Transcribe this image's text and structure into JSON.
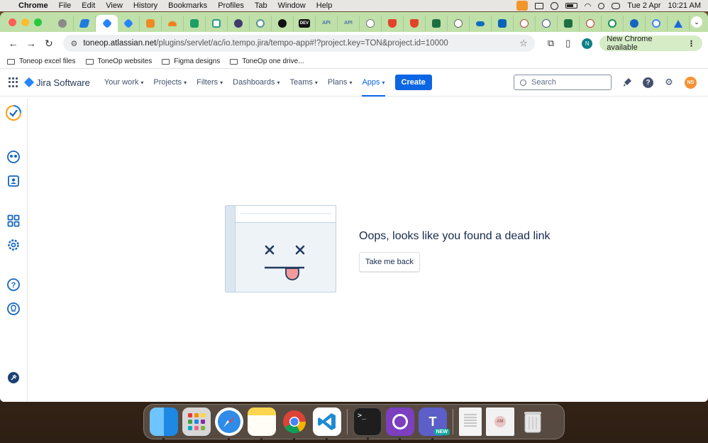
{
  "menubar": {
    "app": "Chrome",
    "items": [
      "File",
      "Edit",
      "View",
      "History",
      "Bookmarks",
      "Profiles",
      "Tab",
      "Window",
      "Help"
    ],
    "date": "Tue 2 Apr",
    "time": "10:21 AM"
  },
  "tabs": {
    "favicons": [
      "apple",
      "tempo",
      "jira",
      "orange-cube",
      "cloudflare",
      "green-doc",
      "teal-square",
      "shield",
      "compass",
      "circle-dark",
      "dev",
      "api-1",
      "api-2",
      "openai",
      "gitlab-1",
      "gitlab-2",
      "excel",
      "chatgpt",
      "onedrive",
      "outlook",
      "grammar",
      "github-desktop",
      "excel-2",
      "grammarly",
      "teal-circle",
      "accessibility",
      "google",
      "atlassian"
    ],
    "dev_label": "DEV",
    "api_label": "API",
    "new_tab": "+",
    "overflow": "⌄"
  },
  "toolbar": {
    "url_host": "toneop.atlassian.net",
    "url_path": "/plugins/servlet/ac/io.tempo.jira/tempo-app#!?project.key=TON&project.id=10000",
    "profile_initial": "N",
    "new_chrome": "New Chrome available"
  },
  "bookmarks": [
    "Toneop excel files",
    "ToneOp websites",
    "Figma designs",
    "ToneOp one drive..."
  ],
  "jira": {
    "product": "Jira Software",
    "nav": [
      "Your work",
      "Projects",
      "Filters",
      "Dashboards",
      "Teams",
      "Plans",
      "Apps"
    ],
    "active_nav": "Apps",
    "create": "Create",
    "search_placeholder": "Search",
    "avatar_initials": "NS"
  },
  "error": {
    "title": "Oops, looks like you found a dead link",
    "button": "Take me back"
  },
  "dock": {
    "apps": [
      "finder",
      "launchpad",
      "safari",
      "notes",
      "chrome",
      "vscode",
      "terminal",
      "github-desktop",
      "teams",
      "preview-doc",
      "meeting-doc",
      "trash"
    ],
    "teams_badge": "NEW",
    "meeting_initials": "AM"
  }
}
